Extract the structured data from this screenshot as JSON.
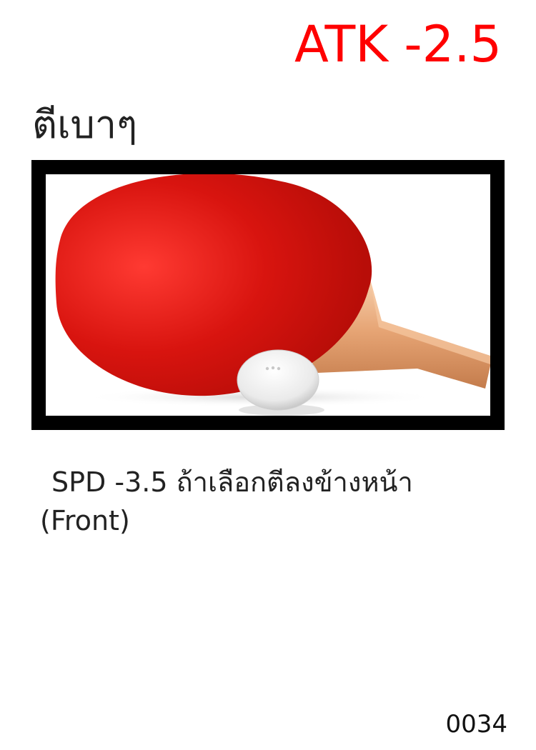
{
  "card": {
    "stat": "ATK -2.5",
    "title": "ตีเบาๆ",
    "illustration": "ping-pong-paddle-icon",
    "effect_line_1": "SPD -3.5 ถ้าเลือกตีลงข้างหน้า",
    "effect_line_2": "(Front)",
    "number": "0034"
  },
  "colors": {
    "stat": "#ff0000",
    "paddle_face": "#c0100c",
    "handle": "#e0a070",
    "frame": "#000000"
  }
}
